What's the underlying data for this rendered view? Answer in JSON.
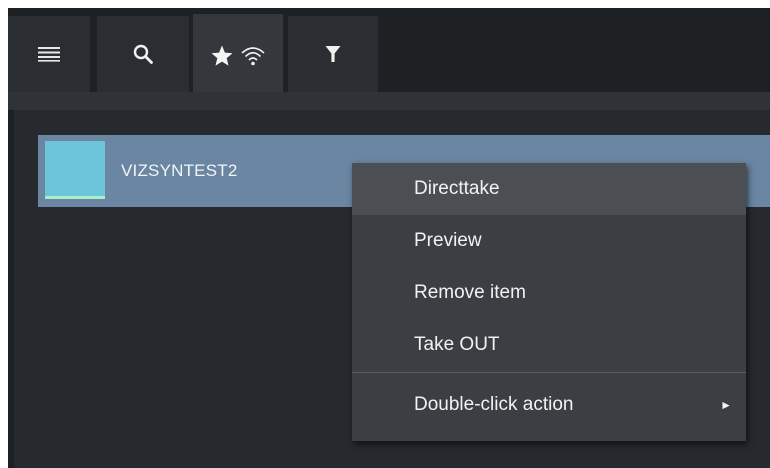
{
  "toolbar": {
    "buttons": [
      {
        "icon": "hamburger-menu-icon"
      },
      {
        "icon": "search-icon"
      },
      {
        "icon": "favorites-live-icon"
      },
      {
        "icon": "filter-icon"
      }
    ],
    "active_index": 2
  },
  "list": {
    "items": [
      {
        "label": "VIZSYNTEST2",
        "thumbnail_color": "#6bc6d9",
        "selected": true
      }
    ]
  },
  "context_menu": {
    "items": [
      {
        "label": "Directtake",
        "highlighted": true
      },
      {
        "label": "Preview"
      },
      {
        "label": "Remove item"
      },
      {
        "label": "Take OUT"
      },
      {
        "label": "Double-click action",
        "submenu": true,
        "arrow": "►"
      }
    ]
  },
  "colors": {
    "background": "#1e2124",
    "selection": "#6a86a2",
    "menu": "#3b3e42",
    "menu_hover": "#4b4f54",
    "accent": "#6bc6d9"
  }
}
